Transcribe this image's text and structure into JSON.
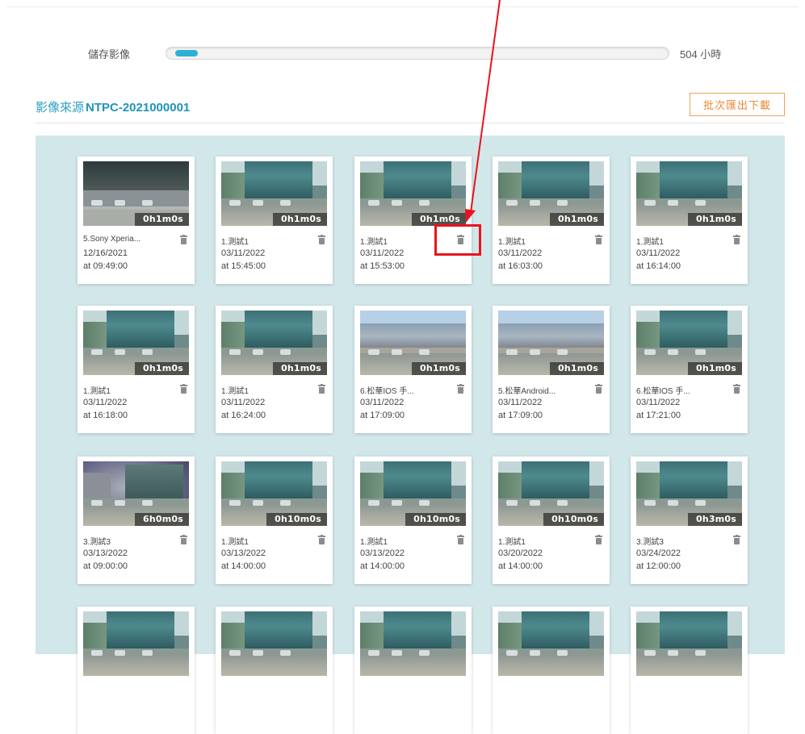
{
  "storage": {
    "label": "儲存影像",
    "value_text": "504 小時",
    "fill_fraction": 0.03,
    "fill_color": "#2cb0d6"
  },
  "source": {
    "label": "影像來源",
    "id": "NTPC-2021000001",
    "batch_button": "批次匯出下載"
  },
  "colors": {
    "accent": "#2a9fc3",
    "gallery_bg": "#d2e7ea",
    "button_orange": "#e88a35",
    "highlight_red": "#e8141d"
  },
  "videos": [
    {
      "name": "5.Sony Xperia...",
      "date": "12/16/2021",
      "time": "at 09:49:00",
      "duration": "0h1m0s",
      "thumb": "style-c"
    },
    {
      "name": "1.測試1",
      "date": "03/11/2022",
      "time": "at 15:45:00",
      "duration": "0h1m0s",
      "thumb": "style-a"
    },
    {
      "name": "1.測試1",
      "date": "03/11/2022",
      "time": "at 15:53:00",
      "duration": "0h1m0s",
      "thumb": "style-a"
    },
    {
      "name": "1.測試1",
      "date": "03/11/2022",
      "time": "at 16:03:00",
      "duration": "0h1m0s",
      "thumb": "style-a"
    },
    {
      "name": "1.測試1",
      "date": "03/11/2022",
      "time": "at 16:14:00",
      "duration": "0h1m0s",
      "thumb": "style-a"
    },
    {
      "name": "1.測試1",
      "date": "03/11/2022",
      "time": "at 16:18:00",
      "duration": "0h1m0s",
      "thumb": "style-a"
    },
    {
      "name": "1.測試1",
      "date": "03/11/2022",
      "time": "at 16:24:00",
      "duration": "0h1m0s",
      "thumb": "style-a"
    },
    {
      "name": "6.松華IOS 手...",
      "date": "03/11/2022",
      "time": "at 17:09:00",
      "duration": "0h1m0s",
      "thumb": "style-b"
    },
    {
      "name": "5.松華Android...",
      "date": "03/11/2022",
      "time": "at 17:09:00",
      "duration": "0h1m0s",
      "thumb": "style-b"
    },
    {
      "name": "6.松華IOS 手...",
      "date": "03/11/2022",
      "time": "at 17:21:00",
      "duration": "0h1m0s",
      "thumb": "style-a"
    },
    {
      "name": "3.測試3",
      "date": "03/13/2022",
      "time": "at 09:00:00",
      "duration": "6h0m0s",
      "thumb": "style-d"
    },
    {
      "name": "1.測試1",
      "date": "03/13/2022",
      "time": "at 14:00:00",
      "duration": "0h10m0s",
      "thumb": "style-a"
    },
    {
      "name": "1.測試1",
      "date": "03/13/2022",
      "time": "at 14:00:00",
      "duration": "0h10m0s",
      "thumb": "style-a"
    },
    {
      "name": "1.測試1",
      "date": "03/20/2022",
      "time": "at 14:00:00",
      "duration": "0h10m0s",
      "thumb": "style-a"
    },
    {
      "name": "3.測試3",
      "date": "03/24/2022",
      "time": "at 12:00:00",
      "duration": "0h3m0s",
      "thumb": "style-a"
    },
    {
      "name": "",
      "date": "",
      "time": "",
      "duration": "",
      "thumb": "style-a"
    },
    {
      "name": "",
      "date": "",
      "time": "",
      "duration": "",
      "thumb": "style-a"
    },
    {
      "name": "",
      "date": "",
      "time": "",
      "duration": "",
      "thumb": "style-a"
    },
    {
      "name": "",
      "date": "",
      "time": "",
      "duration": "",
      "thumb": "style-a"
    },
    {
      "name": "",
      "date": "",
      "time": "",
      "duration": "",
      "thumb": "style-a"
    }
  ],
  "icons": {
    "delete": "trash-icon"
  }
}
